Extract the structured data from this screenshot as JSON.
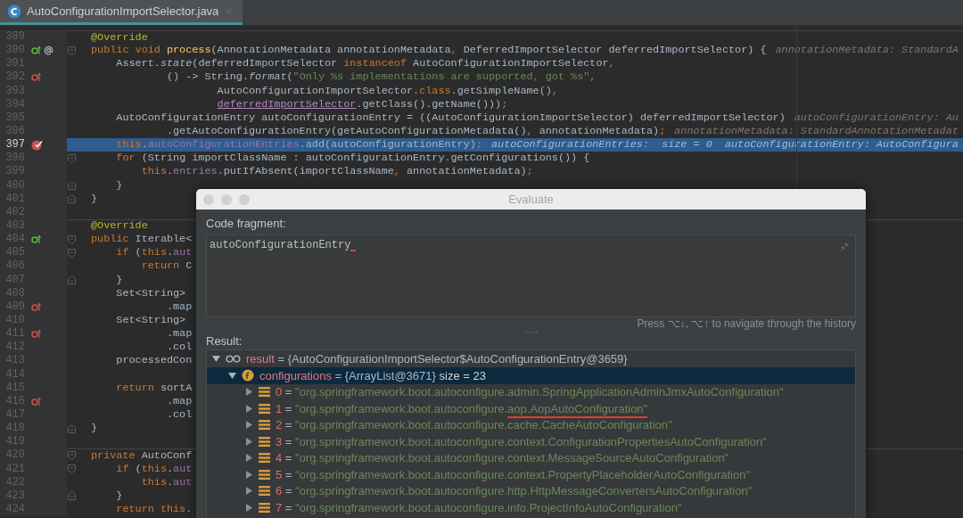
{
  "tab": {
    "title": "AutoConfigurationImportSelector.java",
    "selected": true
  },
  "editor": {
    "lines": [
      {
        "number": "389",
        "selected": false,
        "separator_above": true,
        "code": [
          {
            "kind": "annotation",
            "text": "@Override"
          }
        ]
      },
      {
        "number": "390",
        "selected": false,
        "separator_above": false,
        "markers": [
          {
            "kind": "implements"
          },
          {
            "kind": "at"
          }
        ],
        "fold_start": true,
        "code": [
          {
            "kind": "keyword",
            "text": "public void "
          },
          {
            "kind": "method",
            "text": "process"
          },
          {
            "kind": "plain",
            "text": "(AnnotationMetadata annotationMetadata"
          },
          {
            "kind": "keyword",
            "text": ", "
          },
          {
            "kind": "plain",
            "text": "DeferredImportSelector deferredImportSelector) {"
          }
        ],
        "hint": "annotationMetadata: StandardA"
      },
      {
        "number": "391",
        "selected": false,
        "separator_above": false,
        "code": [
          {
            "kind": "plain",
            "text": "    Assert."
          },
          {
            "kind": "italic",
            "text": "state"
          },
          {
            "kind": "plain",
            "text": "(deferredImportSelector "
          },
          {
            "kind": "keyword",
            "text": "instanceof "
          },
          {
            "kind": "plain",
            "text": "AutoConfigurationImportSelector"
          },
          {
            "kind": "keyword",
            "text": ","
          }
        ]
      },
      {
        "number": "392",
        "selected": false,
        "separator_above": false,
        "markers": [
          {
            "kind": "overrides"
          }
        ],
        "code": [
          {
            "kind": "plain",
            "text": "            () -> String."
          },
          {
            "kind": "italic",
            "text": "format"
          },
          {
            "kind": "plain",
            "text": "("
          },
          {
            "kind": "string",
            "text": "\"Only %s implementations are supported, got %s\""
          },
          {
            "kind": "keyword",
            "text": ","
          }
        ]
      },
      {
        "number": "393",
        "selected": false,
        "separator_above": false,
        "code": [
          {
            "kind": "plain",
            "text": "                    AutoConfigurationImportSelector."
          },
          {
            "kind": "keyword",
            "text": "class"
          },
          {
            "kind": "plain",
            "text": ".getSimpleName()"
          },
          {
            "kind": "keyword",
            "text": ","
          }
        ]
      },
      {
        "number": "394",
        "selected": false,
        "separator_above": false,
        "code": [
          {
            "kind": "param",
            "text": "                    deferredImportSelector"
          },
          {
            "kind": "plain",
            "text": ".getClass().getName()))"
          },
          {
            "kind": "keyword",
            "text": ";"
          }
        ]
      },
      {
        "number": "395",
        "selected": false,
        "separator_above": false,
        "code": [
          {
            "kind": "plain",
            "text": "    AutoConfigurationEntry autoConfigurationEntry = ((AutoConfigurationImportSelector) deferredImportSelector)"
          }
        ],
        "hint": "autoConfigurationEntry: Au"
      },
      {
        "number": "396",
        "selected": false,
        "separator_above": false,
        "code": [
          {
            "kind": "plain",
            "text": "            .getAutoConfigurationEntry(getAutoConfigurationMetadata()"
          },
          {
            "kind": "keyword",
            "text": ", "
          },
          {
            "kind": "plain",
            "text": "annotationMetadata)"
          },
          {
            "kind": "keyword",
            "text": ";"
          }
        ],
        "hint": "annotationMetadata: StandardAnnotationMetadat"
      },
      {
        "number": "397",
        "selected": true,
        "separator_above": false,
        "markers": [
          {
            "kind": "breakpoint"
          }
        ],
        "code": [
          {
            "kind": "keyword",
            "text": "    this"
          },
          {
            "kind": "plain",
            "text": "."
          },
          {
            "kind": "field",
            "text": "autoConfigurationEntries"
          },
          {
            "kind": "plain",
            "text": ".add(autoConfigurationEntry)"
          },
          {
            "kind": "keyword",
            "text": ";"
          }
        ],
        "hint": "autoConfigurationEntries:  size = 0  autoConfigurationEntry: AutoConfigura"
      },
      {
        "number": "398",
        "selected": false,
        "separator_above": false,
        "fold_start": true,
        "code": [
          {
            "kind": "keyword",
            "text": "    for "
          },
          {
            "kind": "plain",
            "text": "(String importClassName : autoConfigurationEntry.getConfigurations()) {"
          }
        ]
      },
      {
        "number": "399",
        "selected": false,
        "separator_above": false,
        "code": [
          {
            "kind": "keyword",
            "text": "        this"
          },
          {
            "kind": "plain",
            "text": "."
          },
          {
            "kind": "field",
            "text": "entries"
          },
          {
            "kind": "plain",
            "text": ".putIfAbsent(importClassName"
          },
          {
            "kind": "keyword",
            "text": ", "
          },
          {
            "kind": "plain",
            "text": "annotationMetadata)"
          },
          {
            "kind": "keyword",
            "text": ";"
          }
        ]
      },
      {
        "number": "400",
        "selected": false,
        "separator_above": false,
        "fold_end": true,
        "code": [
          {
            "kind": "plain",
            "text": "    }"
          }
        ]
      },
      {
        "number": "401",
        "selected": false,
        "separator_above": false,
        "fold_end": true,
        "code": [
          {
            "kind": "plain",
            "text": "}"
          }
        ]
      },
      {
        "number": "402",
        "selected": false,
        "separator_above": false
      },
      {
        "number": "403",
        "selected": false,
        "separator_above": true,
        "code": [
          {
            "kind": "annotation",
            "text": "@Override"
          }
        ]
      },
      {
        "number": "404",
        "selected": false,
        "separator_above": false,
        "markers": [
          {
            "kind": "implements"
          }
        ],
        "fold_start": true,
        "code": [
          {
            "kind": "keyword",
            "text": "public "
          },
          {
            "kind": "plain",
            "text": "Iterable<"
          }
        ]
      },
      {
        "number": "405",
        "selected": false,
        "separator_above": false,
        "fold_start": true,
        "code": [
          {
            "kind": "keyword",
            "text": "    if "
          },
          {
            "kind": "plain",
            "text": "("
          },
          {
            "kind": "keyword",
            "text": "this"
          },
          {
            "kind": "plain",
            "text": "."
          },
          {
            "kind": "field",
            "text": "aut"
          }
        ]
      },
      {
        "number": "406",
        "selected": false,
        "separator_above": false,
        "code": [
          {
            "kind": "keyword",
            "text": "        return "
          },
          {
            "kind": "plain",
            "text": "C"
          }
        ]
      },
      {
        "number": "407",
        "selected": false,
        "separator_above": false,
        "fold_end": true,
        "code": [
          {
            "kind": "plain",
            "text": "    }"
          }
        ]
      },
      {
        "number": "408",
        "selected": false,
        "separator_above": false,
        "code": [
          {
            "kind": "plain",
            "text": "    Set<String>"
          }
        ]
      },
      {
        "number": "409",
        "selected": false,
        "separator_above": false,
        "markers": [
          {
            "kind": "overrides"
          }
        ],
        "code": [
          {
            "kind": "plain",
            "text": "            .map"
          }
        ]
      },
      {
        "number": "410",
        "selected": false,
        "separator_above": false,
        "code": [
          {
            "kind": "plain",
            "text": "    Set<String>"
          }
        ]
      },
      {
        "number": "411",
        "selected": false,
        "separator_above": false,
        "markers": [
          {
            "kind": "overrides"
          }
        ],
        "code": [
          {
            "kind": "plain",
            "text": "            .map"
          }
        ]
      },
      {
        "number": "412",
        "selected": false,
        "separator_above": false,
        "code": [
          {
            "kind": "plain",
            "text": "            .col"
          }
        ]
      },
      {
        "number": "413",
        "selected": false,
        "separator_above": false,
        "code": [
          {
            "kind": "plain",
            "text": "    processedCon"
          }
        ]
      },
      {
        "number": "414",
        "selected": false,
        "separator_above": false
      },
      {
        "number": "415",
        "selected": false,
        "separator_above": false,
        "code": [
          {
            "kind": "keyword",
            "text": "    return "
          },
          {
            "kind": "plain",
            "text": "sortA"
          }
        ]
      },
      {
        "number": "416",
        "selected": false,
        "separator_above": false,
        "markers": [
          {
            "kind": "overrides"
          }
        ],
        "code": [
          {
            "kind": "plain",
            "text": "            .map"
          }
        ]
      },
      {
        "number": "417",
        "selected": false,
        "separator_above": false,
        "code": [
          {
            "kind": "plain",
            "text": "            .col"
          }
        ]
      },
      {
        "number": "418",
        "selected": false,
        "separator_above": false,
        "fold_end": true,
        "code": [
          {
            "kind": "plain",
            "text": "}"
          }
        ]
      },
      {
        "number": "419",
        "selected": false,
        "separator_above": false
      },
      {
        "number": "420",
        "selected": false,
        "separator_above": true,
        "fold_start": true,
        "code": [
          {
            "kind": "keyword",
            "text": "private "
          },
          {
            "kind": "plain",
            "text": "AutoConf"
          }
        ]
      },
      {
        "number": "421",
        "selected": false,
        "separator_above": false,
        "fold_start": true,
        "code": [
          {
            "kind": "keyword",
            "text": "    if "
          },
          {
            "kind": "plain",
            "text": "("
          },
          {
            "kind": "keyword",
            "text": "this"
          },
          {
            "kind": "plain",
            "text": "."
          },
          {
            "kind": "field",
            "text": "aut"
          }
        ]
      },
      {
        "number": "422",
        "selected": false,
        "separator_above": false,
        "code": [
          {
            "kind": "keyword",
            "text": "        this"
          },
          {
            "kind": "plain",
            "text": "."
          },
          {
            "kind": "field",
            "text": "aut"
          }
        ]
      },
      {
        "number": "423",
        "selected": false,
        "separator_above": false,
        "fold_end": true,
        "code": [
          {
            "kind": "plain",
            "text": "    }"
          }
        ]
      },
      {
        "number": "424",
        "selected": false,
        "separator_above": false,
        "code": [
          {
            "kind": "keyword",
            "text": "    return this"
          },
          {
            "kind": "plain",
            "text": "."
          }
        ]
      }
    ]
  },
  "dialog": {
    "title": "Evaluate",
    "code_label": "Code fragment:",
    "code_value": "autoConfigurationEntry",
    "history_hint": "Press ⌥↓, ⌥↑ to navigate through the history",
    "result_label": "Result:",
    "tree": [
      {
        "kind": "watch",
        "name": "result",
        "eq": "=",
        "value": "{AutoConfigurationImportSelector$AutoConfigurationEntry@3659}",
        "expanded": true,
        "selected": false,
        "children": [
          {
            "kind": "field",
            "name": "configurations",
            "eq": "=",
            "value": "{ArrayList@3671}",
            "extra": "size = 23",
            "expanded": true,
            "selected": true,
            "children": [
              {
                "kind": "element",
                "name": "0",
                "eq": "=",
                "parts": [
                  {
                    "text": "\"org.springframework.boot.autoconfigure.admin.SpringApplicationAdminJmxAutoConfiguration\"",
                    "marked": false
                  }
                ],
                "expanded": false,
                "selected": false
              },
              {
                "kind": "element",
                "name": "1",
                "eq": "=",
                "parts": [
                  {
                    "text": "\"org.springframework.boot.autoconfigure.",
                    "marked": false
                  },
                  {
                    "text": "aop.AopAutoConfiguration\"",
                    "marked": true
                  }
                ],
                "expanded": false,
                "selected": false
              },
              {
                "kind": "element",
                "name": "2",
                "eq": "=",
                "parts": [
                  {
                    "text": "\"org.springframework.boot.autoconfigure.cache.CacheAutoConfiguration\"",
                    "marked": false
                  }
                ],
                "expanded": false,
                "selected": false
              },
              {
                "kind": "element",
                "name": "3",
                "eq": "=",
                "parts": [
                  {
                    "text": "\"org.springframework.boot.autoconfigure.context.ConfigurationPropertiesAutoConfiguration\"",
                    "marked": false
                  }
                ],
                "expanded": false,
                "selected": false
              },
              {
                "kind": "element",
                "name": "4",
                "eq": "=",
                "parts": [
                  {
                    "text": "\"org.springframework.boot.autoconfigure.context.MessageSourceAutoConfiguration\"",
                    "marked": false
                  }
                ],
                "expanded": false,
                "selected": false
              },
              {
                "kind": "element",
                "name": "5",
                "eq": "=",
                "parts": [
                  {
                    "text": "\"org.springframework.boot.autoconfigure.context.PropertyPlaceholderAutoConfiguration\"",
                    "marked": false
                  }
                ],
                "expanded": false,
                "selected": false
              },
              {
                "kind": "element",
                "name": "6",
                "eq": "=",
                "parts": [
                  {
                    "text": "\"org.springframework.boot.autoconfigure.http.HttpMessageConvertersAutoConfiguration\"",
                    "marked": false
                  }
                ],
                "expanded": false,
                "selected": false
              },
              {
                "kind": "element",
                "name": "7",
                "eq": "=",
                "parts": [
                  {
                    "text": "\"org.springframework.boot.autoconfigure.info.ProjectInfoAutoConfiguration\"",
                    "marked": false
                  }
                ],
                "expanded": false,
                "selected": false
              }
            ]
          }
        ]
      }
    ]
  }
}
